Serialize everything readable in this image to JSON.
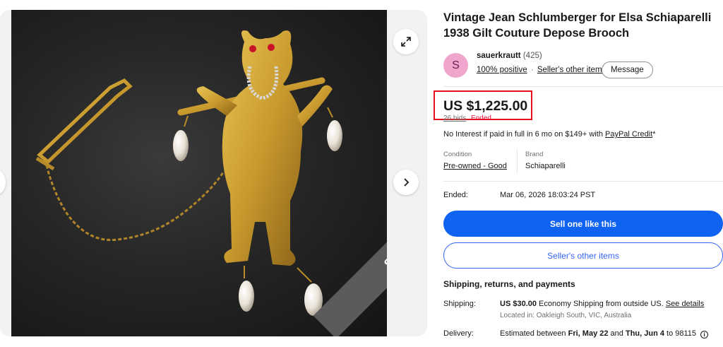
{
  "listing": {
    "title": "Vintage Jean Schlumberger for Elsa Schiaparelli 1938 Gilt Couture Depose Brooch",
    "sold_label": "SOLD"
  },
  "seller": {
    "avatar_letter": "S",
    "name": "sauerkrautt",
    "feedback_count": "(425)",
    "positive": "100% positive",
    "other_items_link": "Seller's other items",
    "separator": "·",
    "message_button": "Message"
  },
  "price": {
    "amount": "US $1,225.00",
    "bids": "26 bids",
    "status": "Ended",
    "finance_text": "No Interest if paid in full in 6 mo on $149+ with",
    "finance_link": "PayPal Credit",
    "finance_suffix": "*"
  },
  "item_specifics": {
    "condition_label": "Condition",
    "condition_value": "Pre-owned - Good",
    "brand_label": "Brand",
    "brand_value": "Schiaparelli"
  },
  "ended": {
    "label": "Ended:",
    "value": "Mar 06, 2026 18:03:24 PST"
  },
  "actions": {
    "sell_one": "Sell one like this",
    "sellers_other_items": "Seller's other items"
  },
  "shipping": {
    "heading": "Shipping, returns, and payments",
    "shipping_label": "Shipping:",
    "shipping_cost": "US $30.00",
    "shipping_method": "Economy Shipping from outside US.",
    "see_details": "See details",
    "location": "Located in: Oakleigh South, VIC, Australia",
    "delivery_label": "Delivery:",
    "delivery_prefix": "Estimated between",
    "delivery_start": "Fri, May 22",
    "delivery_and": "and",
    "delivery_end": "Thu, Jun 4",
    "delivery_to": "to 98115",
    "info_glyph": "i"
  },
  "icons": {
    "expand": "expand-icon",
    "next": "chevron-right-icon",
    "prev": "chevron-left-icon",
    "info": "info-icon"
  },
  "colors": {
    "primary_button": "#0f63f0",
    "secondary_border": "#3665f3",
    "ended_red": "#e0103a",
    "highlight_box": "#e3141b",
    "sold_ribbon": "#5b5b5b",
    "avatar_bg": "#f0a6cc"
  }
}
